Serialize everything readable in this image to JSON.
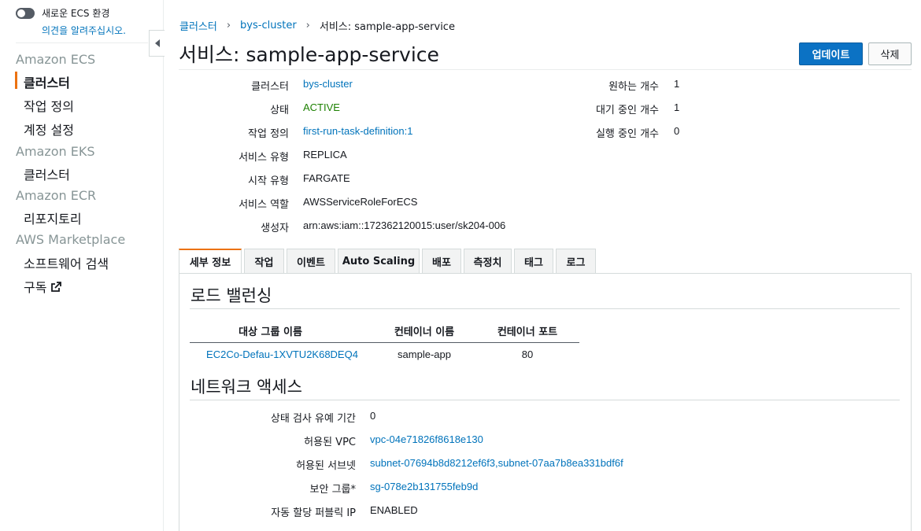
{
  "sidebar": {
    "toggle_label": "새로운 ECS 환경",
    "feedback_link": "의견을 알려주십시오.",
    "groups": [
      {
        "title": "Amazon ECS",
        "items": [
          "클러스터",
          "작업 정의",
          "계정 설정"
        ]
      },
      {
        "title": "Amazon EKS",
        "items": [
          "클러스터"
        ]
      },
      {
        "title": "Amazon ECR",
        "items": [
          "리포지토리"
        ]
      },
      {
        "title": "AWS Marketplace",
        "items": [
          "소프트웨어 검색",
          "구독"
        ]
      }
    ]
  },
  "breadcrumb": {
    "items": [
      "클러스터",
      "bys-cluster",
      "서비스: sample-app-service"
    ]
  },
  "header": {
    "title": "서비스: sample-app-service",
    "update_label": "업데이트",
    "delete_label": "삭제"
  },
  "details": {
    "left": [
      {
        "label": "클러스터",
        "value": "bys-cluster"
      },
      {
        "label": "상태",
        "value": "ACTIVE"
      },
      {
        "label": "작업 정의",
        "value": "first-run-task-definition:1"
      },
      {
        "label": "서비스 유형",
        "value": "REPLICA"
      },
      {
        "label": "시작 유형",
        "value": "FARGATE"
      },
      {
        "label": "서비스 역할",
        "value": "AWSServiceRoleForECS"
      },
      {
        "label": "생성자",
        "value": "arn:aws:iam::172362120015:user/sk204-006"
      }
    ],
    "right": [
      {
        "label": "원하는 개수",
        "value": "1"
      },
      {
        "label": "대기 중인 개수",
        "value": "1"
      },
      {
        "label": "실행 중인 개수",
        "value": "0"
      }
    ]
  },
  "tabs": [
    "세부 정보",
    "작업",
    "이벤트",
    "Auto Scaling",
    "배포",
    "측정치",
    "태그",
    "로그"
  ],
  "load_balancing": {
    "title": "로드 밸런싱",
    "columns": [
      "대상 그룹 이름",
      "컨테이너 이름",
      "컨테이너 포트"
    ],
    "rows": [
      [
        "EC2Co-Defau-1XVTU2K68DEQ4",
        "sample-app",
        "80"
      ]
    ]
  },
  "network": {
    "title": "네트워크 액세스",
    "rows": [
      {
        "label": "상태 검사 유예 기간",
        "value": "0"
      },
      {
        "label": "허용된 VPC",
        "value": "vpc-04e71826f8618e130"
      },
      {
        "label": "허용된 서브넷",
        "value": "subnet-07694b8d8212ef6f3,subnet-07aa7b8ea331bdf6f"
      },
      {
        "label": "보안 그룹*",
        "value": "sg-078e2b131755feb9d"
      },
      {
        "label": "자동 할당 퍼블릭 IP",
        "value": "ENABLED"
      }
    ]
  },
  "colors": {
    "link": "#0073bb",
    "active_status": "#1d8102",
    "accent": "#ec7211",
    "primary_button": "#0b72c4"
  },
  "icons": {
    "external_link": "external-link-icon",
    "collapse": "chevron-left-icon"
  }
}
